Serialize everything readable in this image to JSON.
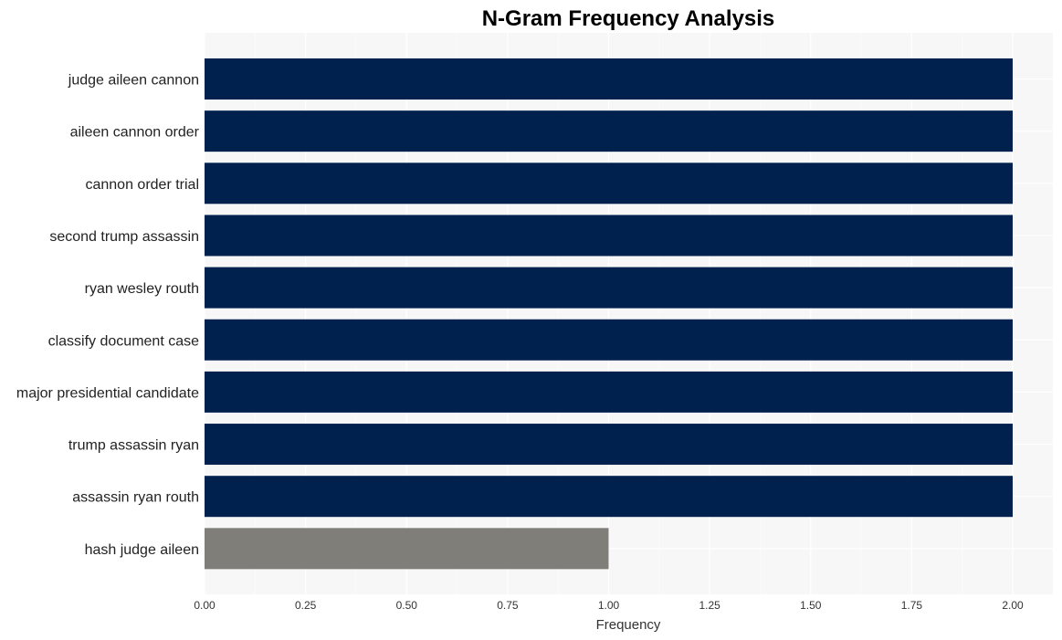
{
  "chart_data": {
    "type": "bar",
    "orientation": "horizontal",
    "title": "N-Gram Frequency Analysis",
    "xlabel": "Frequency",
    "ylabel": "",
    "xlim": [
      0,
      2.0
    ],
    "xticks": [
      "0.00",
      "0.25",
      "0.50",
      "0.75",
      "1.00",
      "1.25",
      "1.50",
      "1.75",
      "2.00"
    ],
    "grid": true,
    "legend": "none",
    "categories": [
      "judge aileen cannon",
      "aileen cannon order",
      "cannon order trial",
      "second trump assassin",
      "ryan wesley routh",
      "classify document case",
      "major presidential candidate",
      "trump assassin ryan",
      "assassin ryan routh",
      "hash judge aileen"
    ],
    "values": [
      2,
      2,
      2,
      2,
      2,
      2,
      2,
      2,
      2,
      1
    ],
    "colors": [
      "#00204e",
      "#00204e",
      "#00204e",
      "#00204e",
      "#00204e",
      "#00204e",
      "#00204e",
      "#00204e",
      "#00204e",
      "#7f7e78"
    ],
    "background": "#f7f7f7"
  }
}
